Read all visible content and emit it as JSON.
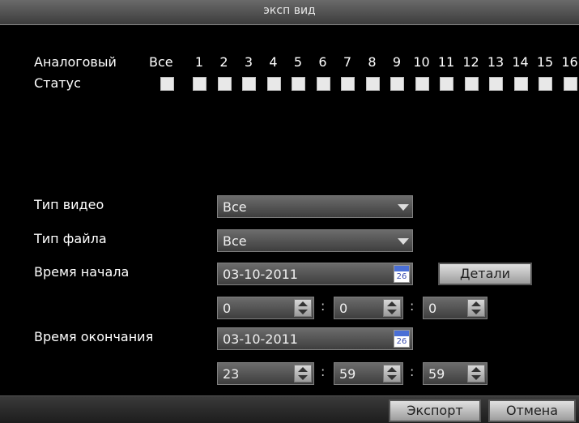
{
  "window": {
    "title": "эксп вид"
  },
  "channels": {
    "analog_label": "Аналоговый",
    "all_label": "Все",
    "status_label": "Статус",
    "numbers": [
      "1",
      "2",
      "3",
      "4",
      "5",
      "6",
      "7",
      "8",
      "9",
      "10",
      "11",
      "12",
      "13",
      "14",
      "15",
      "16"
    ]
  },
  "video_type": {
    "label": "Тип видео",
    "value": "Все"
  },
  "file_type": {
    "label": "Тип файла",
    "value": "Все"
  },
  "start": {
    "label": "Время начала",
    "date": "03-10-2011",
    "calendar_day": "26",
    "details_label": "Детали",
    "hour": "0",
    "minute": "0",
    "second": "0"
  },
  "end": {
    "label": "Время окончания",
    "date": "03-10-2011",
    "calendar_day": "26",
    "hour": "23",
    "minute": "59",
    "second": "59"
  },
  "footer": {
    "export_label": "Экспорт",
    "cancel_label": "Отмена"
  }
}
